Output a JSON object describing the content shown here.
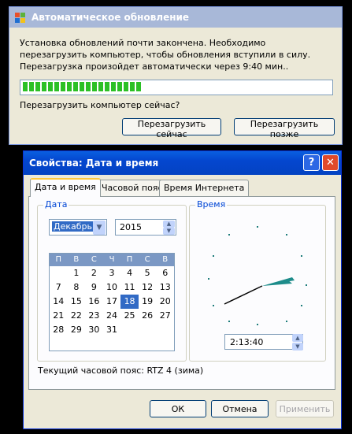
{
  "update_dialog": {
    "title": "Автоматическое обновление",
    "message": "Установка обновлений почти закончена. Необходимо перезагрузить компьютер, чтобы обновления вступили в силу. Перезагрузка произойдет автоматически через 9:40 мин..",
    "progress": 0.39,
    "question": "Перезагрузить компьютер сейчас?",
    "restart_now_label": "Перезагрузить сейчас",
    "restart_later_label": "Перезагрузить позже"
  },
  "datetime_dialog": {
    "title": "Свойства: Дата и время",
    "help_label": "?",
    "close_label": "✕",
    "tabs": [
      "Дата и время",
      "Часовой пояс",
      "Время Интернета"
    ],
    "date_group": {
      "title": "Дата",
      "month": "Декабрь",
      "year": "2015",
      "weekday_headers": [
        "П",
        "В",
        "С",
        "Ч",
        "П",
        "С",
        "В"
      ],
      "days": [
        "",
        "1",
        "2",
        "3",
        "4",
        "5",
        "6",
        "7",
        "8",
        "9",
        "10",
        "11",
        "12",
        "13",
        "14",
        "15",
        "16",
        "17",
        "18",
        "19",
        "20",
        "21",
        "22",
        "23",
        "24",
        "25",
        "26",
        "27",
        "28",
        "29",
        "30",
        "31",
        "",
        "",
        ""
      ],
      "selected_day": "18"
    },
    "time_group": {
      "title": "Время",
      "time_value": "2:13:40"
    },
    "timezone_text": "Текущий часовой пояс: RTZ 4 (зима)",
    "ok_label": "ОК",
    "cancel_label": "Отмена",
    "apply_label": "Применить"
  },
  "colors": {
    "xp_titlebar": "#0446cf",
    "progress_green": "#2bc025",
    "selection_blue": "#316ac5"
  }
}
